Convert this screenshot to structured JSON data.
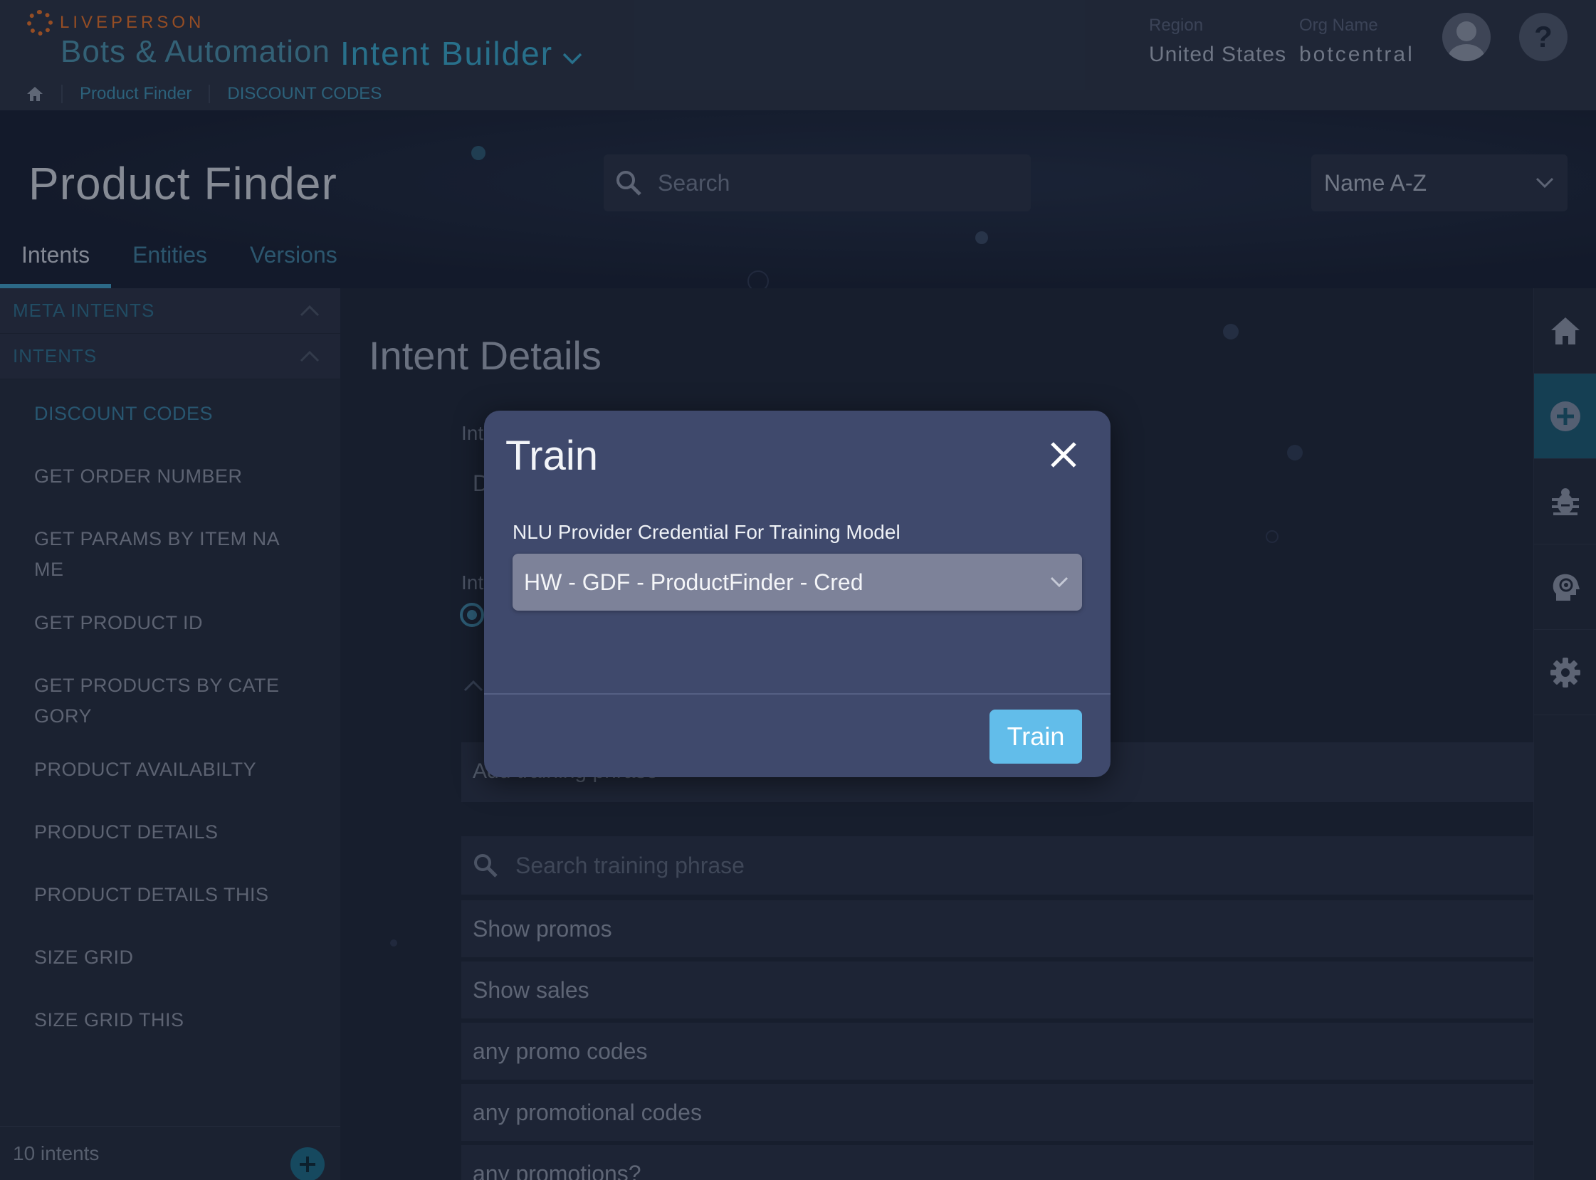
{
  "header": {
    "brand": "LIVEPERSON",
    "product": "Bots & Automation",
    "app": "Intent Builder",
    "region_label": "Region",
    "region_value": "United States",
    "org_label": "Org Name",
    "org_value": "botcentral"
  },
  "breadcrumb": {
    "items": [
      "Product Finder",
      "DISCOUNT CODES"
    ]
  },
  "page": {
    "title": "Product Finder",
    "search_placeholder": "Search",
    "sort_value": "Name A-Z",
    "tabs": [
      "Intents",
      "Entities",
      "Versions"
    ],
    "active_tab": "Intents"
  },
  "sidebar": {
    "meta_section": "META INTENTS",
    "intents_section": "INTENTS",
    "intents": [
      "DISCOUNT CODES",
      "GET ORDER NUMBER",
      "GET PARAMS BY ITEM NA ME",
      "GET PRODUCT ID",
      "GET PRODUCTS BY CATE GORY",
      "PRODUCT AVAILABILTY",
      "PRODUCT DETAILS",
      "PRODUCT DETAILS THIS",
      "SIZE GRID",
      "SIZE GRID THIS"
    ],
    "active_intent": "DISCOUNT CODES",
    "count_label": "10 intents"
  },
  "main": {
    "title": "Intent Details",
    "field1_label_fragment": "Int",
    "field1_value_fragment": "D",
    "field2_label_fragment": "Int",
    "training_input_fragment": "Add training phrase",
    "training_search_placeholder": "Search training phrase",
    "phrases": [
      "Show promos",
      "Show sales",
      "any promo codes",
      "any promotional codes",
      "any promotions?"
    ]
  },
  "rail": {
    "icons": [
      "home-icon",
      "add-icon",
      "bug-icon",
      "brain-icon",
      "gear-icon"
    ],
    "active": "add-icon"
  },
  "modal": {
    "title": "Train",
    "field_label": "NLU Provider Credential For Training Model",
    "selected_credential": "HW - GDF - ProductFinder - Cred",
    "submit_label": "Train"
  },
  "colors": {
    "accent": "#62bdea",
    "modal_bg": "#3f496c",
    "brand_orange": "#e0702c",
    "link_blue": "#3f8fb0"
  }
}
